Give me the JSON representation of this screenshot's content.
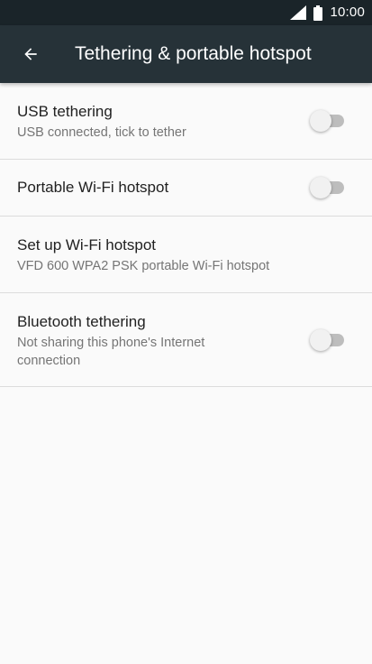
{
  "status_bar": {
    "time": "10:00",
    "icons": [
      "signal-icon",
      "battery-icon"
    ]
  },
  "app_bar": {
    "back_icon": "arrow-back-icon",
    "title": "Tethering & portable hotspot"
  },
  "settings": [
    {
      "title": "USB tethering",
      "subtitle": "USB connected, tick to tether",
      "toggle": false
    },
    {
      "title": "Portable Wi-Fi hotspot",
      "toggle": false
    },
    {
      "title": "Set up Wi-Fi hotspot",
      "subtitle": "VFD 600 WPA2 PSK portable Wi-Fi hotspot"
    },
    {
      "title": "Bluetooth tethering",
      "subtitle": "Not sharing this phone's Internet connection",
      "toggle": false
    }
  ],
  "colors": {
    "status_bar": "#1a2429",
    "app_bar": "#263238",
    "background": "#fafafa",
    "title_text": "#212121",
    "subtitle_text": "#757575",
    "divider": "#dcdcdc"
  }
}
